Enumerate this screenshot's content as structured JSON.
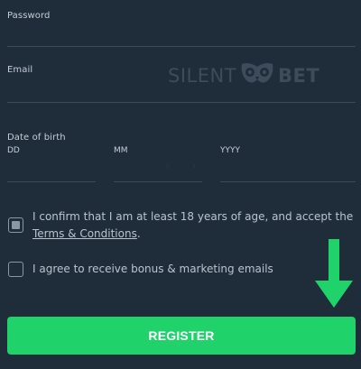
{
  "form": {
    "password": {
      "label": "Password",
      "value": "",
      "placeholder": ""
    },
    "email": {
      "label": "Email",
      "value": "",
      "placeholder": ""
    },
    "dob": {
      "label": "Date of birth",
      "day_label": "DD",
      "month_label": "MM",
      "year_label": "YYYY"
    },
    "age_confirm": {
      "checked": true,
      "text": "I confirm that I am at least 18 years of age, and accept the",
      "link": "Terms & Conditions",
      "suffix": "."
    },
    "marketing": {
      "checked": false,
      "text": "I agree to receive bonus & marketing emails"
    },
    "register_label": "REGISTER"
  },
  "watermark": {
    "left": "SILENT",
    "right": "BET",
    "icon": "owl-icon"
  },
  "arrow": {
    "icon": "arrow-down-icon",
    "color": "#1fd36a"
  },
  "colors": {
    "background": "#1f2d3a",
    "accent": "#1fd36a",
    "line": "#3a4a59"
  }
}
